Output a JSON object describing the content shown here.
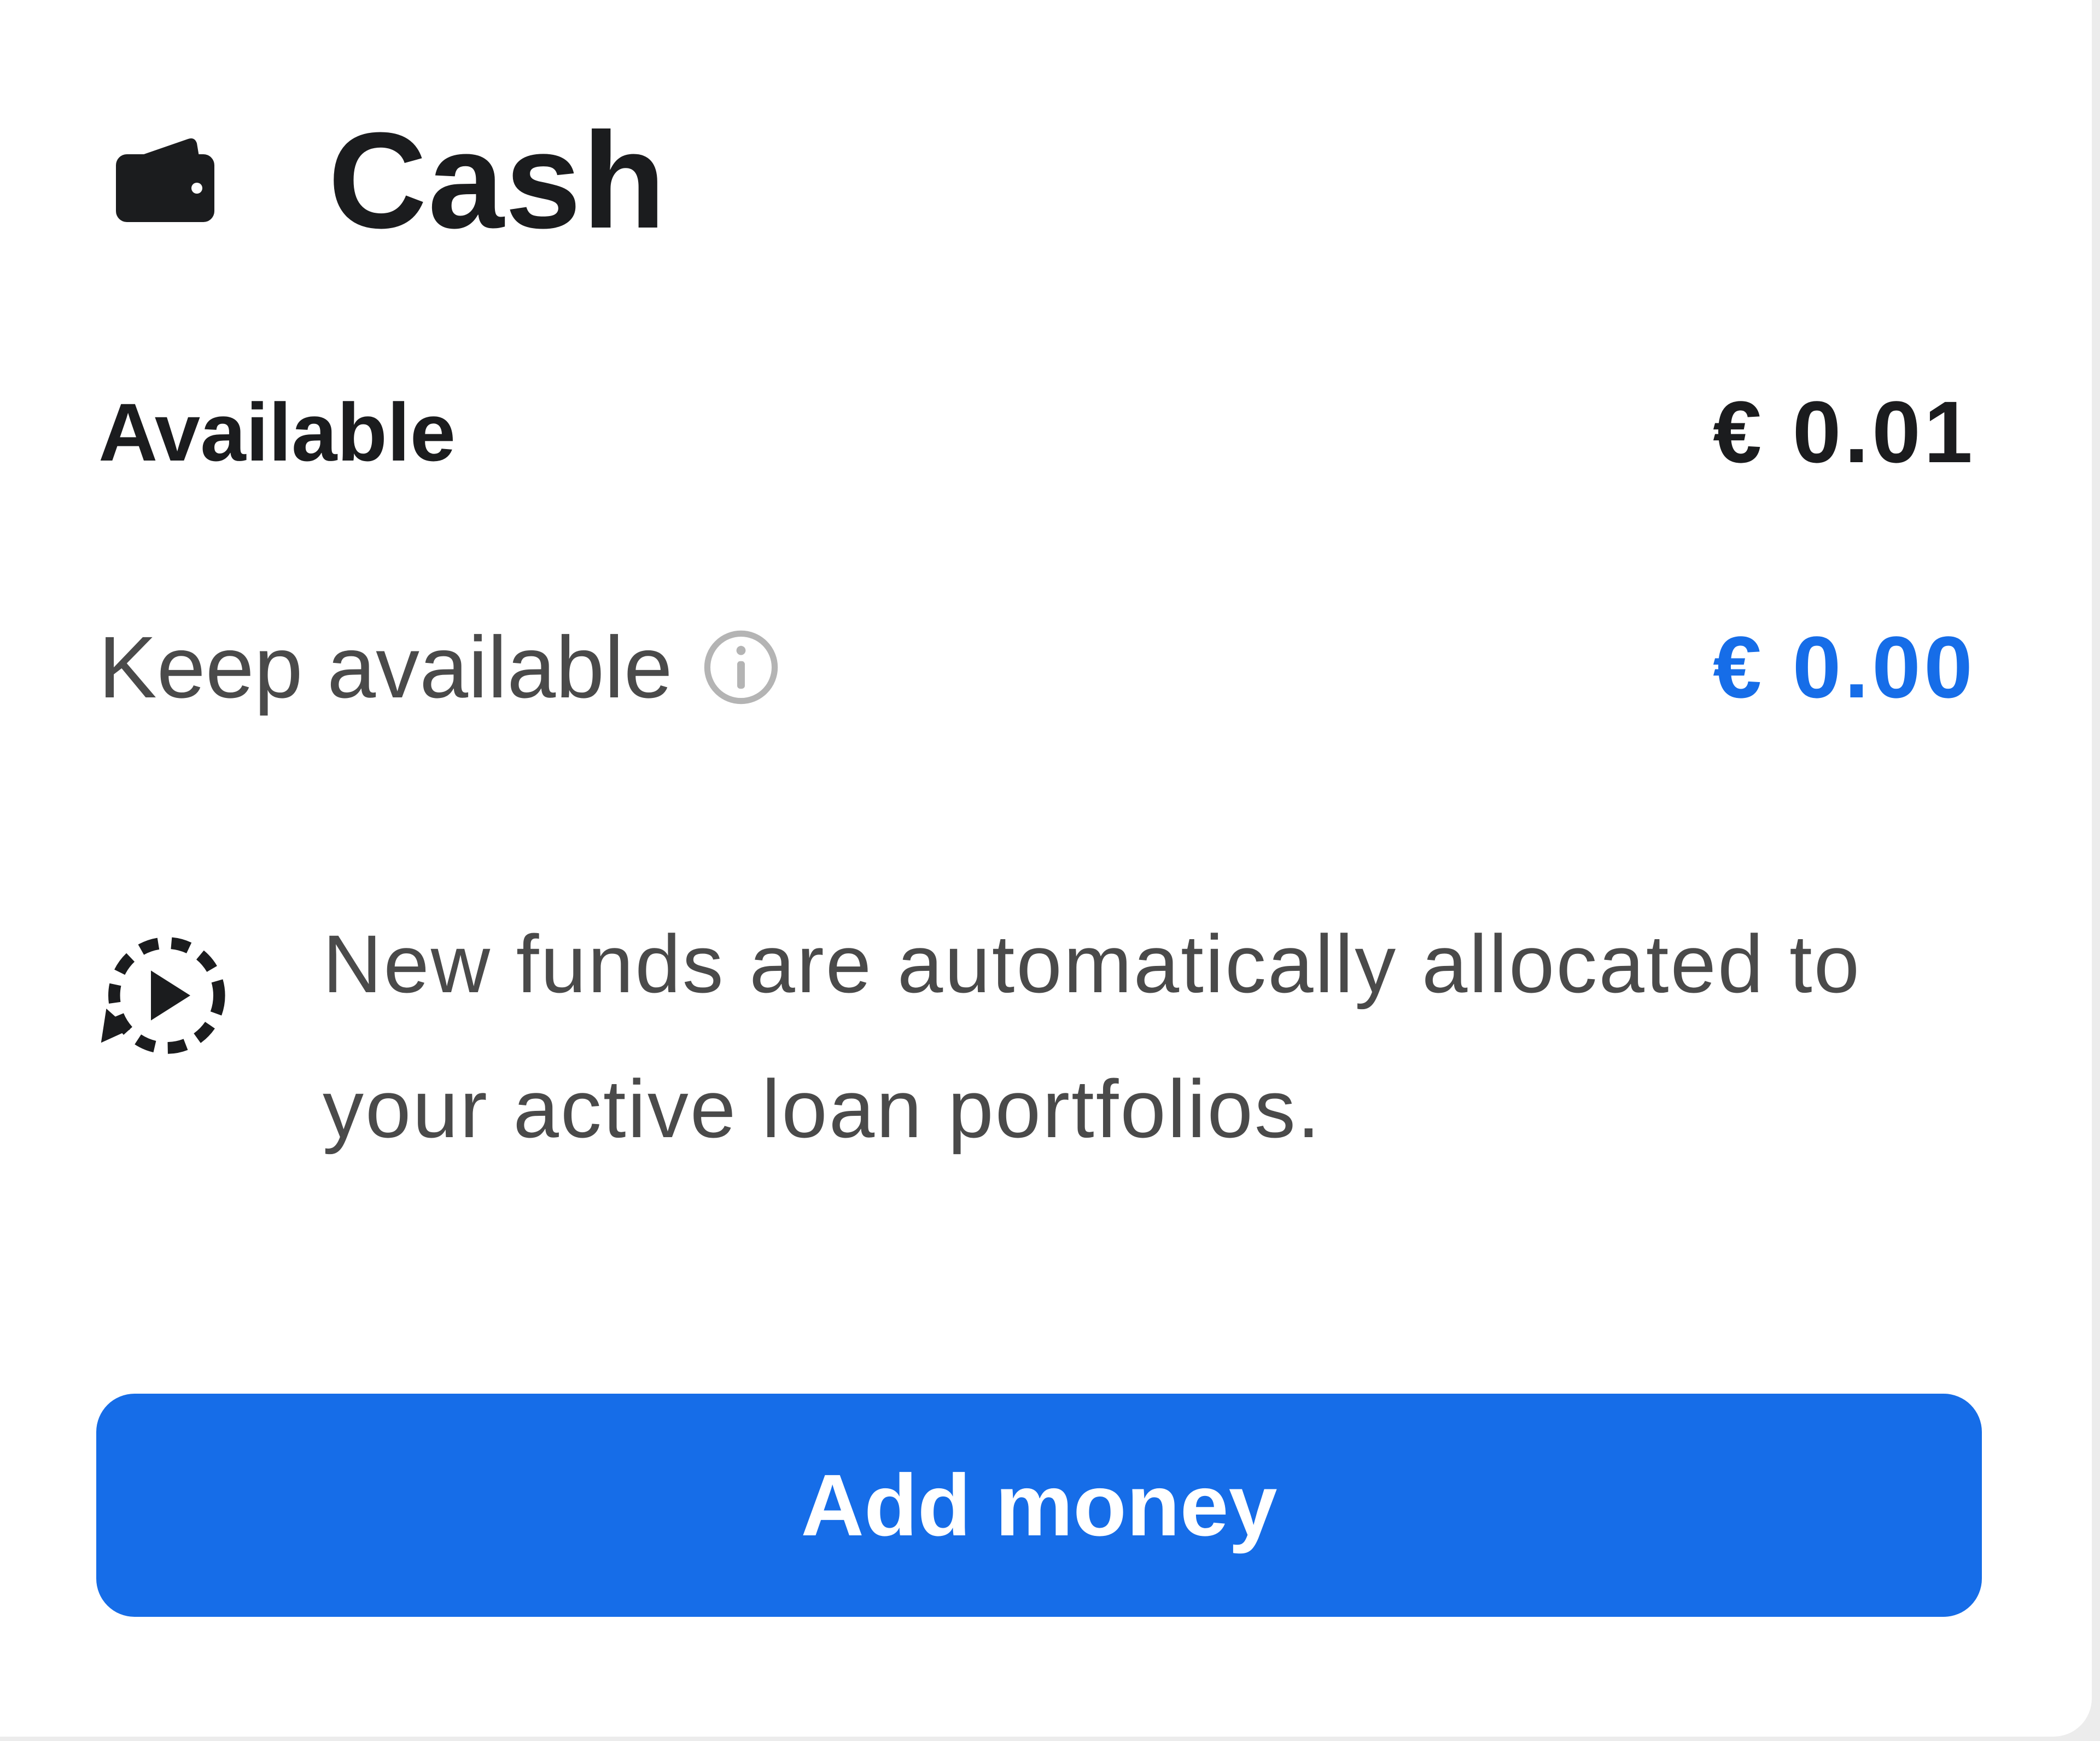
{
  "card": {
    "title": "Cash",
    "title_icon": "wallet-icon"
  },
  "available": {
    "label": "Available",
    "value": "€ 0.01"
  },
  "keep_available": {
    "label": "Keep available",
    "info_icon": "info-icon",
    "value": "€ 0.00"
  },
  "notice": {
    "icon": "auto-allocate-icon",
    "text": "New funds are automatically allocated to your active loan portfolios."
  },
  "actions": {
    "add_money_label": "Add money"
  },
  "colors": {
    "accent": "#166de8",
    "text_primary": "#1b1c1e",
    "text_secondary": "#4a4a4a",
    "icon_muted": "#b4b4b4"
  }
}
